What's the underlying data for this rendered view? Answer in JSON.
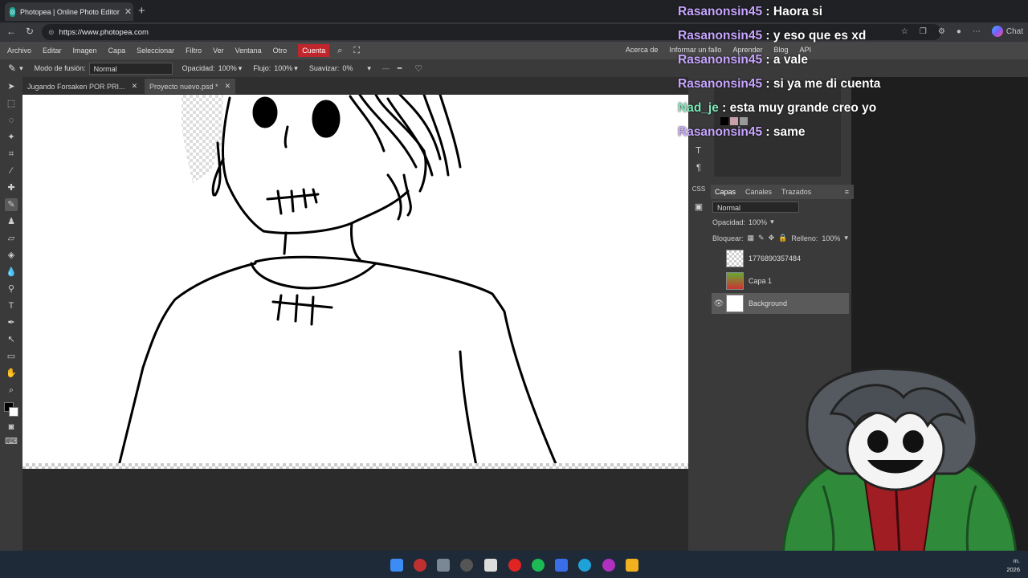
{
  "browser": {
    "tab_title": "Photopea | Online Photo Editor",
    "url": "https://www.photopea.com",
    "chat_label": "Chat"
  },
  "menu": {
    "items": [
      "Archivo",
      "Editar",
      "Imagen",
      "Capa",
      "Seleccionar",
      "Filtro",
      "Ver",
      "Ventana",
      "Otro"
    ],
    "account": "Cuenta",
    "right": [
      "Acerca de",
      "Informar un fallo",
      "Aprender",
      "Blog",
      "API"
    ]
  },
  "options": {
    "blend_label": "Modo de fusión:",
    "blend_value": "Normal",
    "opacity_label": "Opacidad:",
    "opacity_value": "100%",
    "flow_label": "Flujo:",
    "flow_value": "100%",
    "smooth_label": "Suavizar:",
    "smooth_value": "0%"
  },
  "doc_tabs": [
    {
      "label": "Jugando Forsaken POR PRI..."
    },
    {
      "label": "Proyecto nuevo.psd *"
    }
  ],
  "layers_panel": {
    "tabs": [
      "Capas",
      "Canales",
      "Trazados"
    ],
    "blend": "Normal",
    "opacity_label": "Opacidad:",
    "opacity_value": "100%",
    "lock_label": "Bloquear:",
    "fill_label": "Relleno:",
    "fill_value": "100%",
    "layers": [
      {
        "name": "1776890357484"
      },
      {
        "name": "Capa 1"
      },
      {
        "name": "Background"
      }
    ]
  },
  "chat": [
    {
      "user": "Rasanonsin45",
      "text": ": Haora si"
    },
    {
      "user": "Rasanonsin45",
      "text": ": y eso que es xd"
    },
    {
      "user": "Rasanonsin45",
      "text": ": a vale"
    },
    {
      "user": "Rasanonsin45",
      "text": ": si ya me di cuenta"
    },
    {
      "user": "Nad_je",
      "text": ": esta muy grande creo yo"
    },
    {
      "user": "Rasanonsin45",
      "text": ": same"
    }
  ],
  "clock": {
    "line1": "m.",
    "line2": "2026"
  },
  "colors": {
    "accent": "#c0272d",
    "chat_user": "#c7a6ff",
    "chat_user_alt": "#7de8b8"
  }
}
